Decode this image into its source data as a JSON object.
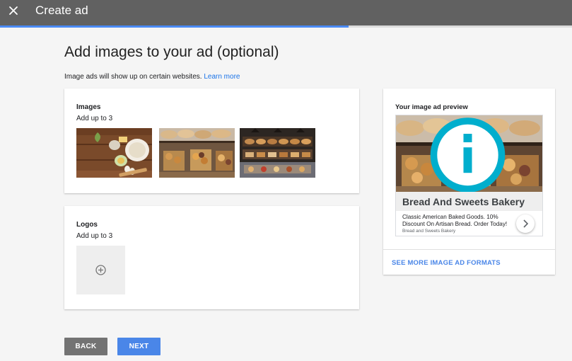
{
  "header": {
    "title": "Create ad",
    "close_icon": "close-icon",
    "progress_percent": 61
  },
  "main": {
    "title": "Add images to your ad (optional)",
    "subtitle": "Image ads will show up on certain websites.",
    "learn_more": "Learn more"
  },
  "images_section": {
    "label": "Images",
    "hint": "Add up to 3",
    "thumbnails": [
      "baking-ingredients-image",
      "bakery-pastry-display-image",
      "bakery-shop-counter-image"
    ]
  },
  "logos_section": {
    "label": "Logos",
    "hint": "Add up to 3",
    "upload_icon": "add-circle-icon"
  },
  "preview": {
    "label": "Your image ad preview",
    "headline": "Bread And Sweets Bakery",
    "description": "Classic American Baked Goods. 10% Discount On Artisan Bread. Order Today!",
    "domain": "Bread and Sweets Bakery",
    "see_more": "SEE MORE IMAGE AD FORMATS"
  },
  "footer": {
    "back_label": "BACK",
    "next_label": "NEXT"
  },
  "colors": {
    "topbar": "#616161",
    "accent": "#4a86e8",
    "back_button": "#737373"
  }
}
